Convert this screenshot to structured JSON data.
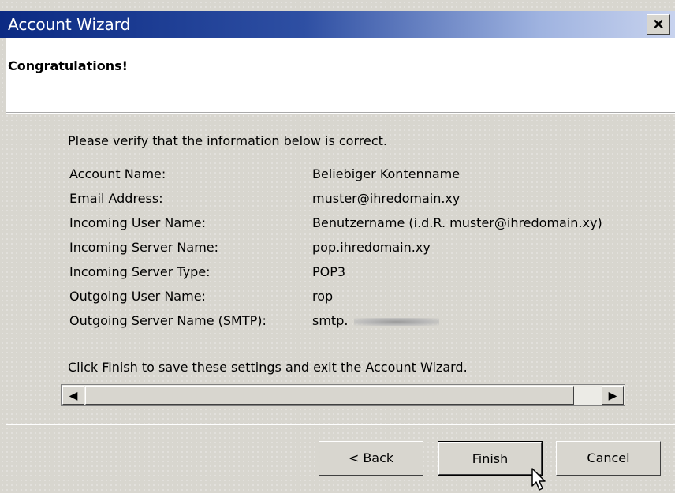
{
  "window": {
    "title": "Account Wizard",
    "close_label": "✕"
  },
  "header": {
    "title": "Congratulations!"
  },
  "content": {
    "intro": "Please verify that the information below is correct.",
    "rows": [
      {
        "label": "Account Name:",
        "value": "Beliebiger Kontenname"
      },
      {
        "label": "Email Address:",
        "value": "muster@ihredomain.xy"
      },
      {
        "label": "Incoming User Name:",
        "value": "Benutzername (i.d.R. muster@ihredomain.xy)"
      },
      {
        "label": "Incoming Server Name:",
        "value": "pop.ihredomain.xy"
      },
      {
        "label": "Incoming Server Type:",
        "value": "POP3"
      },
      {
        "label": "Outgoing User Name:",
        "value": "rop"
      },
      {
        "label": "Outgoing Server Name (SMTP):",
        "value": "smtp."
      }
    ],
    "outro": "Click Finish to save these settings and exit the Account Wizard."
  },
  "scrollbar": {
    "left_arrow": "◀",
    "right_arrow": "▶"
  },
  "buttons": {
    "back": "< Back",
    "finish": "Finish",
    "cancel": "Cancel"
  },
  "colors": {
    "titlebar_start": "#0b2a83",
    "titlebar_end": "#c8d3ee",
    "dialog_bg": "#d8d6cf"
  }
}
